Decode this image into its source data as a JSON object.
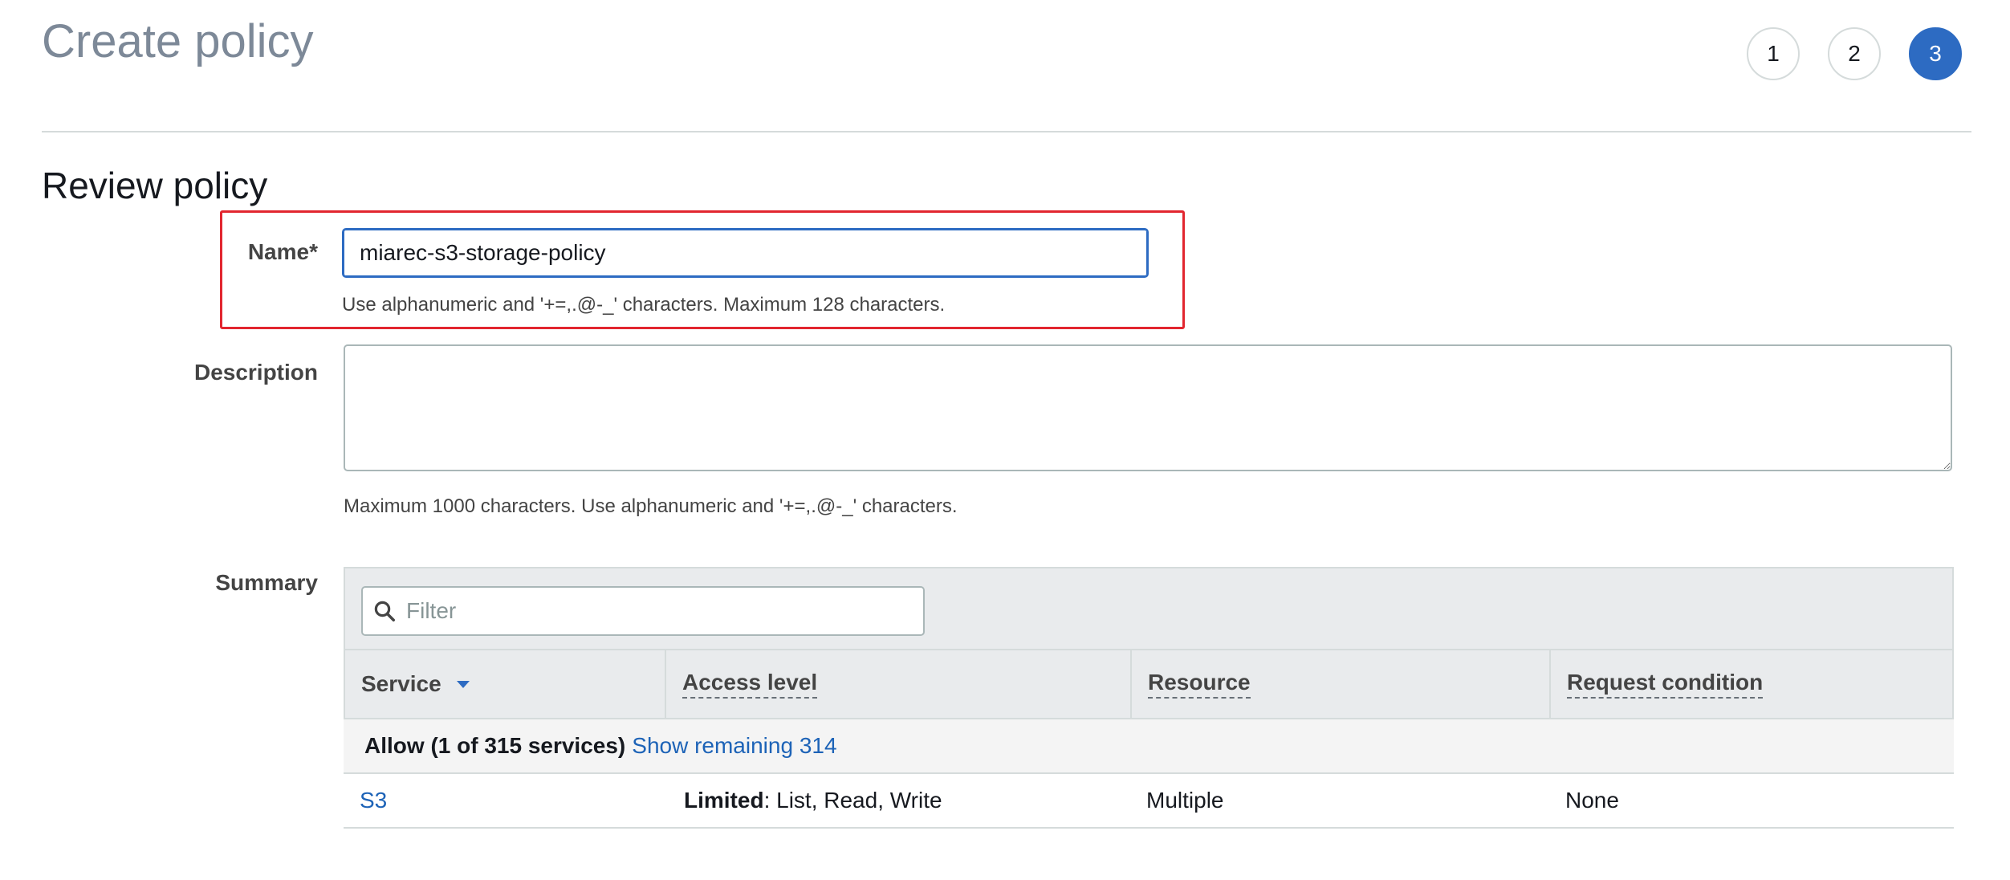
{
  "page": {
    "title": "Create policy"
  },
  "steps": [
    "1",
    "2",
    "3"
  ],
  "active_step": "3",
  "section": {
    "title": "Review policy"
  },
  "form": {
    "name_label": "Name*",
    "name_value": "miarec-s3-storage-policy",
    "name_hint": "Use alphanumeric and '+=,.@-_' characters. Maximum 128 characters.",
    "description_label": "Description",
    "description_value": "",
    "description_hint": "Maximum 1000 characters. Use alphanumeric and '+=,.@-_' characters.",
    "summary_label": "Summary"
  },
  "summary": {
    "filter_placeholder": "Filter",
    "columns": [
      "Service",
      "Access level",
      "Resource",
      "Request condition"
    ],
    "group": {
      "label": "Allow (1 of 315 services)",
      "link": "Show remaining 314"
    },
    "rows": [
      {
        "service": "S3",
        "access_level_strong": "Limited",
        "access_level_rest": ": List, Read, Write",
        "resource": "Multiple",
        "condition": "None"
      }
    ]
  },
  "colors": {
    "accent": "#2d6bc2",
    "highlight": "#e2262f",
    "link": "#1d63b7"
  },
  "icons": {
    "filter": "search-icon",
    "sort": "caret-down-icon"
  }
}
